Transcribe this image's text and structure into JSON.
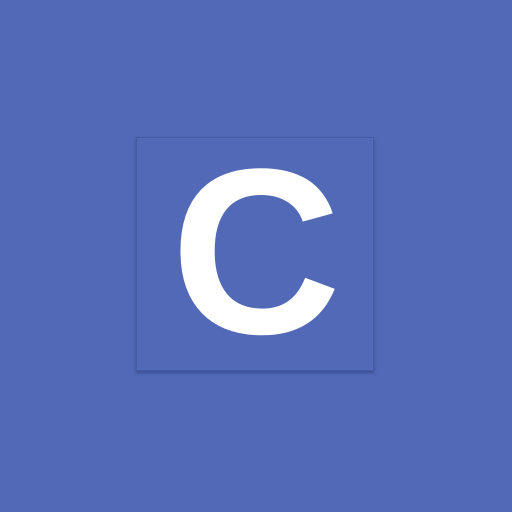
{
  "colors": {
    "background": "#5169b6",
    "tile": "#5169b6",
    "letter": "#ffffff"
  },
  "app_icon": {
    "letter": "C",
    "icon_name": "app-icon-letter-c"
  }
}
